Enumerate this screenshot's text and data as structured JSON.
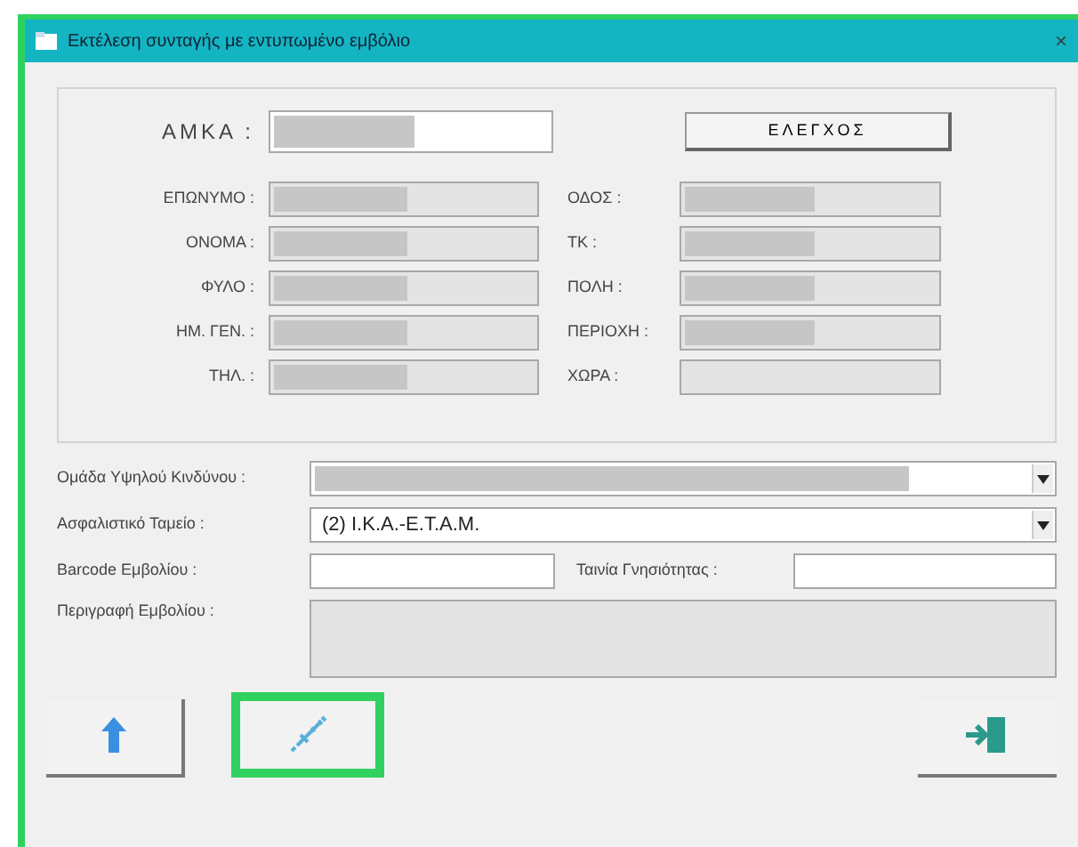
{
  "window": {
    "title": "Εκτέλεση συνταγής με εντυπωμένο εμβόλιο",
    "close": "×"
  },
  "amka": {
    "label": "ΑΜΚΑ :",
    "masked": true
  },
  "check_button": "ΕΛΕΓΧΟΣ",
  "left_fields": [
    {
      "label": "ΕΠΩΝΥΜΟ :",
      "masked": true
    },
    {
      "label": "ΟΝΟΜΑ :",
      "masked": true
    },
    {
      "label": "ΦΥΛΟ :",
      "masked": true
    },
    {
      "label": "ΗΜ. ΓΕΝ. :",
      "masked": true
    },
    {
      "label": "ΤΗΛ. :",
      "masked": true
    }
  ],
  "right_fields": [
    {
      "label": "ΟΔΟΣ :",
      "masked": true
    },
    {
      "label": "ΤΚ :",
      "masked": true
    },
    {
      "label": "ΠΟΛΗ :",
      "masked": true
    },
    {
      "label": "ΠΕΡΙΟΧΗ :",
      "masked": true
    },
    {
      "label": "ΧΩΡΑ :",
      "masked": false
    }
  ],
  "risk_group": {
    "label": "Ομάδα Υψηλού Κινδύνου :",
    "masked": true
  },
  "insurance_fund": {
    "label": "Ασφαλιστικό Ταμείο :",
    "value": "(2) I.K.A.-E.T.A.M."
  },
  "barcode": {
    "label": "Barcode Εμβολίου :"
  },
  "seal": {
    "label": "Ταινία Γνησιότητας :"
  },
  "description": {
    "label": "Περιγραφή Εμβολίου :"
  },
  "toolbar": [
    {
      "kind": "upload",
      "highlighted": false
    },
    {
      "kind": "syringe",
      "highlighted": true
    },
    {
      "kind": "exit",
      "highlighted": false
    }
  ]
}
